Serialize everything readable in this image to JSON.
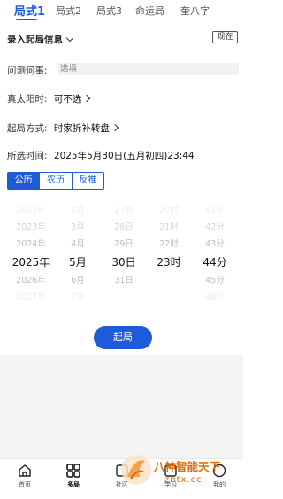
{
  "tabs": [
    {
      "label": "局式1",
      "active": true
    },
    {
      "label": "局式2"
    },
    {
      "label": "局式3"
    },
    {
      "label": "命运局"
    },
    {
      "label": "奎八字"
    }
  ],
  "section": {
    "title": "录入起局信息",
    "now_button": "现在"
  },
  "question": {
    "label": "问测何事:",
    "placeholder": "选填"
  },
  "solar_time": {
    "label": "真太阳时:",
    "value": "可不选"
  },
  "method": {
    "label": "起局方式:",
    "value": "时家拆补转盘"
  },
  "selected_time": {
    "label": "所选时间:",
    "value": "2025年5月30日(五月初四)23:44"
  },
  "calendar_modes": [
    {
      "label": "公历",
      "active": true
    },
    {
      "label": "农历"
    },
    {
      "label": "反推"
    }
  ],
  "picker": {
    "year": [
      "2022年",
      "2023年",
      "2024年",
      "2025年",
      "2026年",
      "2027年"
    ],
    "month": [
      "2月",
      "3月",
      "4月",
      "5月",
      "6月",
      "7月"
    ],
    "day": [
      "27日",
      "28日",
      "29日",
      "30日",
      "31日",
      ""
    ],
    "hour": [
      "20时",
      "21时",
      "22时",
      "23时",
      "",
      ""
    ],
    "minute": [
      "41分",
      "42分",
      "43分",
      "44分",
      "45分",
      "46分"
    ]
  },
  "start_button": "起局",
  "bottom_nav": [
    {
      "label": "首页",
      "icon": "home-icon"
    },
    {
      "label": "多局",
      "icon": "grid-icon"
    },
    {
      "label": "社区",
      "icon": "community-icon"
    },
    {
      "label": "学习",
      "icon": "study-icon"
    },
    {
      "label": "我的",
      "icon": "profile-icon"
    }
  ],
  "watermark": {
    "line1": "八神智能天下",
    "line2": "zntx.cc"
  },
  "colors": {
    "accent": "#1e5bd8",
    "watermark": "#e06a00"
  }
}
